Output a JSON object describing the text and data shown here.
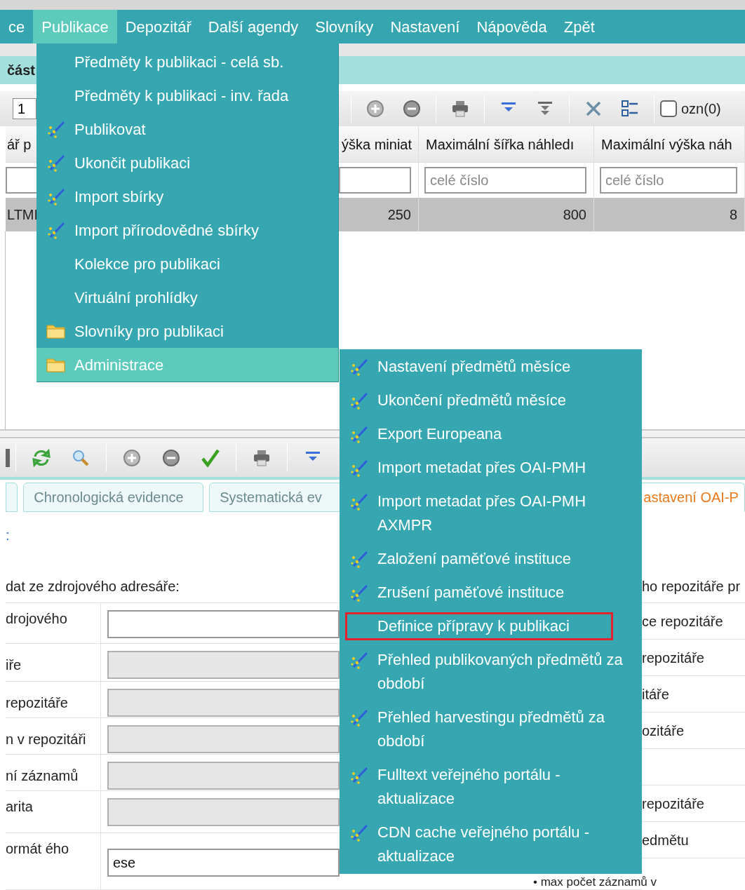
{
  "menubar": [
    {
      "label": "ce",
      "selected": false
    },
    {
      "label": "Publikace",
      "selected": true
    },
    {
      "label": "Depozitář",
      "selected": false
    },
    {
      "label": "Další agendy",
      "selected": false
    },
    {
      "label": "Slovníky",
      "selected": false
    },
    {
      "label": "Nastavení",
      "selected": false
    },
    {
      "label": "Nápověda",
      "selected": false
    },
    {
      "label": "Zpět",
      "selected": false
    }
  ],
  "publikace_menu": [
    {
      "label": "Předměty k publikaci - celá sb.",
      "kind": "plain",
      "selected": false
    },
    {
      "label": "Předměty k publikaci - inv. řada",
      "kind": "plain",
      "selected": false
    },
    {
      "label": "Publikovat",
      "kind": "action",
      "selected": false
    },
    {
      "label": "Ukončit publikaci",
      "kind": "action",
      "selected": false
    },
    {
      "label": "Import sbírky",
      "kind": "action",
      "selected": false
    },
    {
      "label": "Import přírodovědné sbírky",
      "kind": "action",
      "selected": false
    },
    {
      "label": "Kolekce pro publikaci",
      "kind": "plain",
      "selected": false
    },
    {
      "label": "Virtuální prohlídky",
      "kind": "plain",
      "selected": false
    },
    {
      "label": "Slovníky pro publikaci",
      "kind": "folder",
      "selected": false
    },
    {
      "label": "Administrace",
      "kind": "folder",
      "selected": true
    }
  ],
  "administrace_submenu": [
    {
      "label": "Nastavení předmětů měsíce",
      "kind": "action",
      "outlined": false
    },
    {
      "label": "Ukončení předmětů měsíce",
      "kind": "action",
      "outlined": false
    },
    {
      "label": "Export Europeana",
      "kind": "action",
      "outlined": false
    },
    {
      "label": "Import metadat přes OAI-PMH",
      "kind": "action",
      "outlined": false
    },
    {
      "label": "Import metadat přes OAI-PMH AXMPR",
      "kind": "action",
      "outlined": false
    },
    {
      "label": "Založení paměťové instituce",
      "kind": "action",
      "outlined": false
    },
    {
      "label": "Zrušení paměťové instituce",
      "kind": "action",
      "outlined": false
    },
    {
      "label": "Definice přípravy k publikaci",
      "kind": "plain",
      "outlined": true
    },
    {
      "label": "Přehled publikovaných předmětů za období",
      "kind": "action",
      "outlined": false
    },
    {
      "label": "Přehled harvestingu předmětů za období",
      "kind": "action",
      "outlined": false
    },
    {
      "label": "Fulltext veřejného portálu - aktualizace",
      "kind": "action",
      "outlined": false
    },
    {
      "label": "CDN cache veřejného portálu - aktualizace",
      "kind": "action",
      "outlined": false
    }
  ],
  "panel_title": "část",
  "toolbar": {
    "page": "1",
    "checkbox": {
      "label": "ozn(0)",
      "checked": false
    }
  },
  "grid": {
    "columns": [
      "ář p",
      "ýška miniat",
      "Maximální šířka náhledı",
      "Maximální výška náh"
    ],
    "filters": [
      {
        "kind": "field"
      },
      {
        "kind": "field"
      },
      {
        "kind": "field",
        "placeholder": "celé číslo"
      },
      {
        "kind": "field",
        "placeholder": "celé číslo"
      }
    ],
    "rows": [
      {
        "cells": [
          "LTMI",
          "250",
          "800",
          "8"
        ],
        "selected": true
      }
    ]
  },
  "tabs": [
    {
      "label": "Chronologická evidence",
      "selected": false
    },
    {
      "label": "Systematická ev",
      "selected": false
    },
    {
      "label": "astavení OAI-P",
      "selected": true
    }
  ],
  "link_fragment": ":",
  "section_heading": "dat ze zdrojového adresáře:",
  "right_heading": "ho repozitáře pr",
  "form_left": [
    {
      "label": "drojového",
      "disabled": false
    },
    {
      "label": "iře",
      "disabled": true
    },
    {
      "label": "repozitáře",
      "disabled": true
    },
    {
      "label": "n v repozitáři",
      "disabled": true
    },
    {
      "label": "ní záznamů",
      "disabled": true
    },
    {
      "label": "arita",
      "disabled": true
    },
    {
      "label": "ormát ého",
      "value": "ese",
      "disabled": false
    }
  ],
  "form_right": [
    {
      "kind": "label",
      "label": "ce repozitáře"
    },
    {
      "kind": "label",
      "label": "repozitáře"
    },
    {
      "kind": "label",
      "label": "itáře"
    },
    {
      "kind": "label",
      "label": "ozitáře"
    },
    {
      "kind": "blank"
    },
    {
      "kind": "label",
      "label": "repozitáře"
    },
    {
      "kind": "label",
      "label": "edmětu"
    },
    {
      "kind": "wide",
      "label": "• max počet záznamů v"
    }
  ]
}
